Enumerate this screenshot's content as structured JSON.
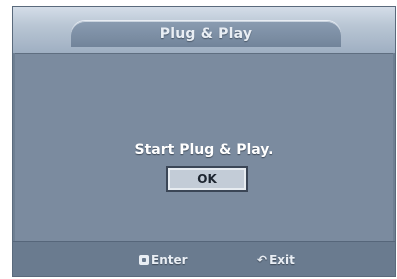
{
  "dialog": {
    "title": "Plug & Play",
    "message": "Start Plug & Play.",
    "ok_label": "OK"
  },
  "footer": {
    "enter_label": "Enter",
    "exit_label": "Exit",
    "enter_icon": "enter-icon",
    "exit_icon": "return-icon"
  },
  "colors": {
    "panel": "#7b8b9f",
    "title_bar": "#b9c6d4",
    "button": "#c3ccd7"
  }
}
